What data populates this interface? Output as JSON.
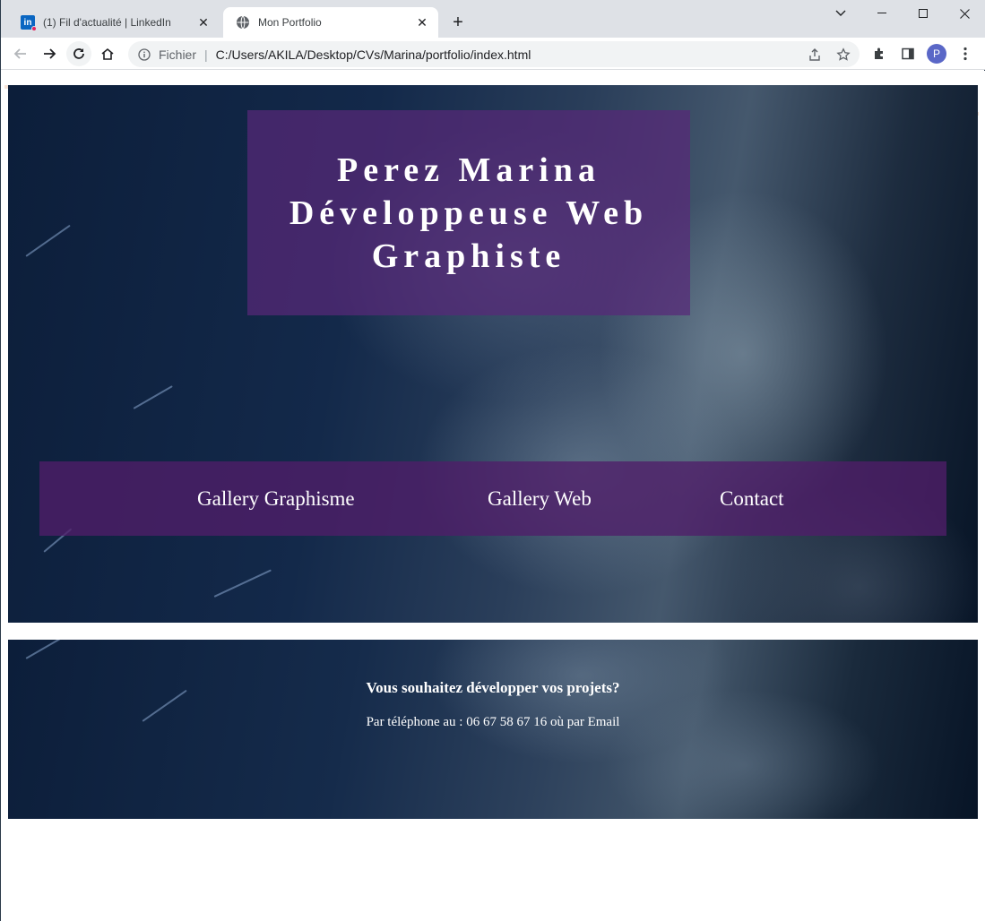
{
  "browser": {
    "tabs": [
      {
        "title": "(1) Fil d'actualité | LinkedIn",
        "icon": "linkedin-icon",
        "active": false
      },
      {
        "title": "Mon Portfolio",
        "icon": "globe-icon",
        "active": true
      }
    ],
    "address": {
      "scheme_label": "Fichier",
      "url": "C:/Users/AKILA/Desktop/CVs/Marina/portfolio/index.html"
    },
    "profile_initial": "P"
  },
  "hero": {
    "title_lines": [
      "Perez Marina",
      "Développeuse Web",
      "Graphiste"
    ],
    "nav": [
      "Gallery Graphisme",
      "Gallery Web",
      "Contact"
    ]
  },
  "footer": {
    "title": "Vous souhaitez développer vos projets?",
    "contact_text": "Par téléphone au : 06 67 58 67 16 où par Email"
  },
  "colors": {
    "overlay_purple": "#582878",
    "nav_purple": "#501e69",
    "background_navy": "#0c1e3a"
  }
}
